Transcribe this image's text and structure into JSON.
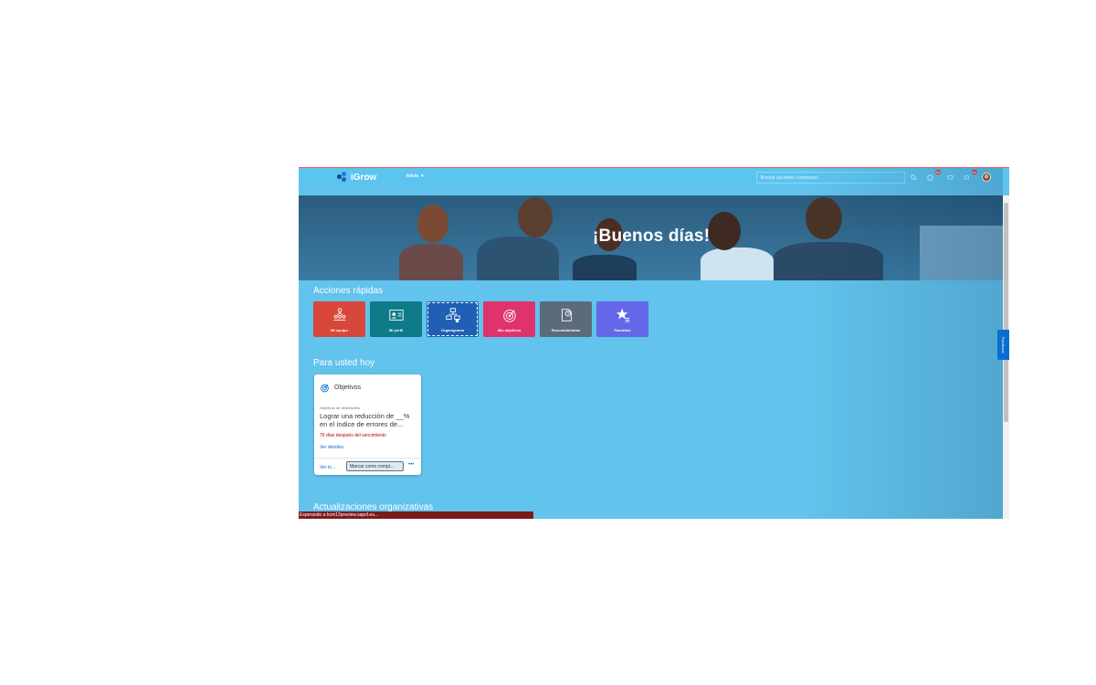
{
  "header": {
    "logo_text": "iGrow",
    "nav_label": "Inicio",
    "search_placeholder": "Buscar acciones o personas",
    "notifications_badge_a": "54",
    "notifications_badge_b": "54"
  },
  "hero": {
    "greeting": "¡Buenos días!"
  },
  "quick_actions": {
    "title": "Acciones rápidas",
    "items": [
      {
        "label": "Mi equipo",
        "color": "#d9473b",
        "icon": "team-icon"
      },
      {
        "label": "Mi perfil",
        "color": "#0e7a8a",
        "icon": "profile-card-icon"
      },
      {
        "label": "Organigrama",
        "color": "#1f5fb4",
        "icon": "org-chart-icon"
      },
      {
        "label": "Mis objetivos",
        "color": "#e0336e",
        "icon": "target-icon"
      },
      {
        "label": "Reconsiderarlas",
        "color": "#5b6b7a",
        "icon": "history-icon"
      },
      {
        "label": "Favoritos",
        "color": "#6467e8",
        "icon": "favorites-icon"
      }
    ]
  },
  "today": {
    "title": "Para usted hoy",
    "card": {
      "title": "Objetivos",
      "subtitle": "Objetivos de desempeño",
      "text": "Lograr una reducción de __% en el índice de errores de...",
      "overdue": "76 días después del vencimiento",
      "details_link": "Ver detalles",
      "see_all": "Ver to...",
      "mark_button": "Marcar como compl...",
      "more": "•••"
    }
  },
  "org_updates": {
    "title": "Actualizaciones organizativas"
  },
  "feedback_label": "Feedback",
  "status_bar": "Esperando a hcm12preview.sapsf.eu..."
}
